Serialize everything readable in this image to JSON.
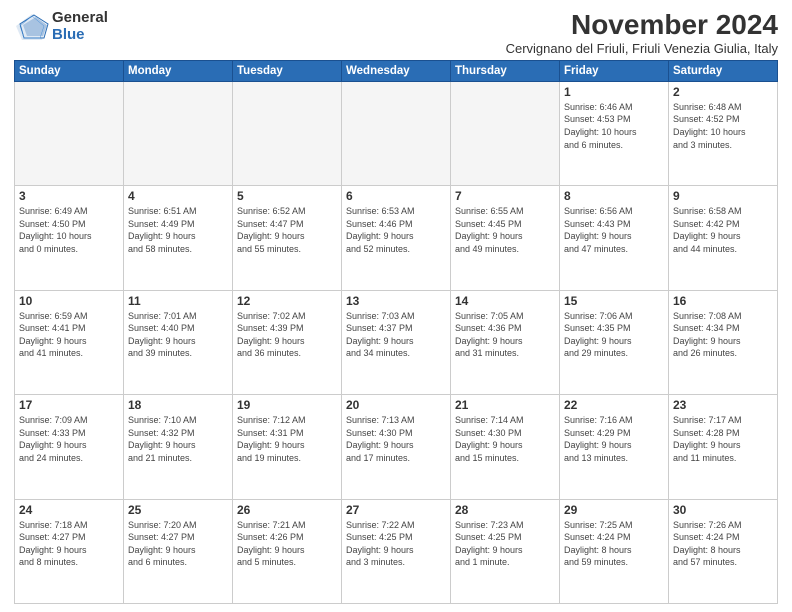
{
  "logo": {
    "general": "General",
    "blue": "Blue"
  },
  "title": "November 2024",
  "subtitle": "Cervignano del Friuli, Friuli Venezia Giulia, Italy",
  "headers": [
    "Sunday",
    "Monday",
    "Tuesday",
    "Wednesday",
    "Thursday",
    "Friday",
    "Saturday"
  ],
  "weeks": [
    [
      {
        "day": "",
        "info": ""
      },
      {
        "day": "",
        "info": ""
      },
      {
        "day": "",
        "info": ""
      },
      {
        "day": "",
        "info": ""
      },
      {
        "day": "",
        "info": ""
      },
      {
        "day": "1",
        "info": "Sunrise: 6:46 AM\nSunset: 4:53 PM\nDaylight: 10 hours\nand 6 minutes."
      },
      {
        "day": "2",
        "info": "Sunrise: 6:48 AM\nSunset: 4:52 PM\nDaylight: 10 hours\nand 3 minutes."
      }
    ],
    [
      {
        "day": "3",
        "info": "Sunrise: 6:49 AM\nSunset: 4:50 PM\nDaylight: 10 hours\nand 0 minutes."
      },
      {
        "day": "4",
        "info": "Sunrise: 6:51 AM\nSunset: 4:49 PM\nDaylight: 9 hours\nand 58 minutes."
      },
      {
        "day": "5",
        "info": "Sunrise: 6:52 AM\nSunset: 4:47 PM\nDaylight: 9 hours\nand 55 minutes."
      },
      {
        "day": "6",
        "info": "Sunrise: 6:53 AM\nSunset: 4:46 PM\nDaylight: 9 hours\nand 52 minutes."
      },
      {
        "day": "7",
        "info": "Sunrise: 6:55 AM\nSunset: 4:45 PM\nDaylight: 9 hours\nand 49 minutes."
      },
      {
        "day": "8",
        "info": "Sunrise: 6:56 AM\nSunset: 4:43 PM\nDaylight: 9 hours\nand 47 minutes."
      },
      {
        "day": "9",
        "info": "Sunrise: 6:58 AM\nSunset: 4:42 PM\nDaylight: 9 hours\nand 44 minutes."
      }
    ],
    [
      {
        "day": "10",
        "info": "Sunrise: 6:59 AM\nSunset: 4:41 PM\nDaylight: 9 hours\nand 41 minutes."
      },
      {
        "day": "11",
        "info": "Sunrise: 7:01 AM\nSunset: 4:40 PM\nDaylight: 9 hours\nand 39 minutes."
      },
      {
        "day": "12",
        "info": "Sunrise: 7:02 AM\nSunset: 4:39 PM\nDaylight: 9 hours\nand 36 minutes."
      },
      {
        "day": "13",
        "info": "Sunrise: 7:03 AM\nSunset: 4:37 PM\nDaylight: 9 hours\nand 34 minutes."
      },
      {
        "day": "14",
        "info": "Sunrise: 7:05 AM\nSunset: 4:36 PM\nDaylight: 9 hours\nand 31 minutes."
      },
      {
        "day": "15",
        "info": "Sunrise: 7:06 AM\nSunset: 4:35 PM\nDaylight: 9 hours\nand 29 minutes."
      },
      {
        "day": "16",
        "info": "Sunrise: 7:08 AM\nSunset: 4:34 PM\nDaylight: 9 hours\nand 26 minutes."
      }
    ],
    [
      {
        "day": "17",
        "info": "Sunrise: 7:09 AM\nSunset: 4:33 PM\nDaylight: 9 hours\nand 24 minutes."
      },
      {
        "day": "18",
        "info": "Sunrise: 7:10 AM\nSunset: 4:32 PM\nDaylight: 9 hours\nand 21 minutes."
      },
      {
        "day": "19",
        "info": "Sunrise: 7:12 AM\nSunset: 4:31 PM\nDaylight: 9 hours\nand 19 minutes."
      },
      {
        "day": "20",
        "info": "Sunrise: 7:13 AM\nSunset: 4:30 PM\nDaylight: 9 hours\nand 17 minutes."
      },
      {
        "day": "21",
        "info": "Sunrise: 7:14 AM\nSunset: 4:30 PM\nDaylight: 9 hours\nand 15 minutes."
      },
      {
        "day": "22",
        "info": "Sunrise: 7:16 AM\nSunset: 4:29 PM\nDaylight: 9 hours\nand 13 minutes."
      },
      {
        "day": "23",
        "info": "Sunrise: 7:17 AM\nSunset: 4:28 PM\nDaylight: 9 hours\nand 11 minutes."
      }
    ],
    [
      {
        "day": "24",
        "info": "Sunrise: 7:18 AM\nSunset: 4:27 PM\nDaylight: 9 hours\nand 8 minutes."
      },
      {
        "day": "25",
        "info": "Sunrise: 7:20 AM\nSunset: 4:27 PM\nDaylight: 9 hours\nand 6 minutes."
      },
      {
        "day": "26",
        "info": "Sunrise: 7:21 AM\nSunset: 4:26 PM\nDaylight: 9 hours\nand 5 minutes."
      },
      {
        "day": "27",
        "info": "Sunrise: 7:22 AM\nSunset: 4:25 PM\nDaylight: 9 hours\nand 3 minutes."
      },
      {
        "day": "28",
        "info": "Sunrise: 7:23 AM\nSunset: 4:25 PM\nDaylight: 9 hours\nand 1 minute."
      },
      {
        "day": "29",
        "info": "Sunrise: 7:25 AM\nSunset: 4:24 PM\nDaylight: 8 hours\nand 59 minutes."
      },
      {
        "day": "30",
        "info": "Sunrise: 7:26 AM\nSunset: 4:24 PM\nDaylight: 8 hours\nand 57 minutes."
      }
    ]
  ]
}
